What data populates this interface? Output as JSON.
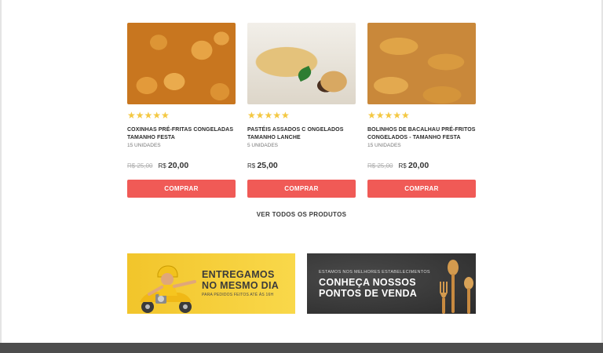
{
  "products": [
    {
      "name": "COXINHAS PRÉ-FRITAS CONGELADAS TAMANHO FESTA",
      "quantity": "15 UNIDADES",
      "old_price": "R$ 25,00",
      "currency": "R$",
      "price": "20,00",
      "rating": 5,
      "stars": "★★★★★",
      "button": "COMPRAR"
    },
    {
      "name": "PASTÉIS ASSADOS C ONGELADOS TAMANHO LANCHE",
      "quantity": "5 UNIDADES",
      "old_price": "",
      "currency": "R$",
      "price": "25,00",
      "rating": 5,
      "stars": "★★★★★",
      "button": "COMPRAR"
    },
    {
      "name": "BOLINHOS DE BACALHAU PRÉ-FRITOS CONGELADOS - TAMANHO FESTA",
      "quantity": "15 UNIDADES",
      "old_price": "R$ 25,00",
      "currency": "R$",
      "price": "20,00",
      "rating": 5,
      "stars": "★★★★★",
      "button": "COMPRAR"
    }
  ],
  "see_all": "VER TODOS OS PRODUTOS",
  "banners": {
    "delivery": {
      "title_line1": "ENTREGAMOS",
      "title_line2": "NO MESMO DIA",
      "subtitle": "PARA PEDIDOS FEITOS ATÉ ÀS 16H"
    },
    "stores": {
      "kicker": "ESTAMOS NOS MELHORES ESTABELECIMENTOS",
      "title_line1": "CONHEÇA NOSSOS",
      "title_line2": "PONTOS DE VENDA"
    }
  },
  "colors": {
    "buy_button": "#f05a56",
    "stars": "#f4c842",
    "delivery_banner": "#f5cd36",
    "stores_banner": "#333333",
    "footer": "#4d4d4d"
  },
  "icons": [
    "star-icon",
    "courier-scooter-icon",
    "wooden-utensils-icon"
  ]
}
